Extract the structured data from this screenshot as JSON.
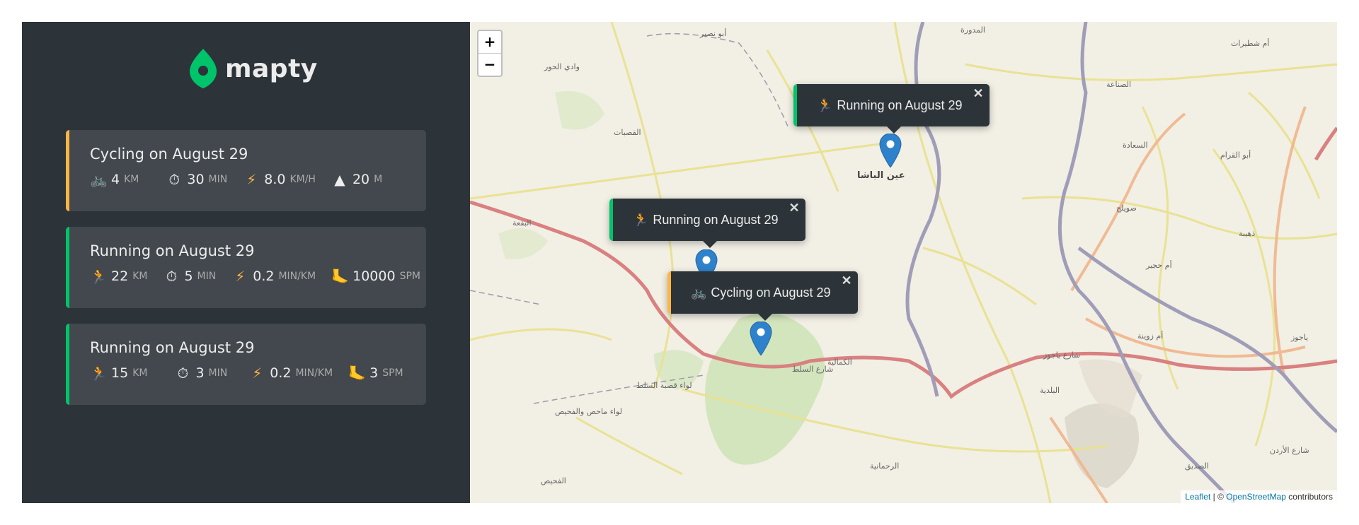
{
  "app": {
    "logo_text": "mapty",
    "accent_colors": {
      "running": "#00c46a",
      "cycling": "#ffb545",
      "sidebar": "#2d3439",
      "card": "#42484d"
    }
  },
  "workouts": [
    {
      "type": "cycling",
      "title": "Cycling on August 29",
      "details": [
        {
          "icon": "bicycle-icon",
          "value": "4",
          "unit": "km"
        },
        {
          "icon": "stopwatch-icon",
          "value": "30",
          "unit": "min"
        },
        {
          "icon": "lightning-icon",
          "value": "8.0",
          "unit": "km/h"
        },
        {
          "icon": "mountain-icon",
          "value": "20",
          "unit": "m"
        }
      ]
    },
    {
      "type": "running",
      "title": "Running on August 29",
      "details": [
        {
          "icon": "runner-icon",
          "value": "22",
          "unit": "km"
        },
        {
          "icon": "stopwatch-icon",
          "value": "5",
          "unit": "min"
        },
        {
          "icon": "lightning-icon",
          "value": "0.2",
          "unit": "min/km"
        },
        {
          "icon": "foot-icon",
          "value": "10000",
          "unit": "spm"
        }
      ]
    },
    {
      "type": "running",
      "title": "Running on August 29",
      "details": [
        {
          "icon": "runner-icon",
          "value": "15",
          "unit": "km"
        },
        {
          "icon": "stopwatch-icon",
          "value": "3",
          "unit": "min"
        },
        {
          "icon": "lightning-icon",
          "value": "0.2",
          "unit": "min/km"
        },
        {
          "icon": "foot-icon",
          "value": "3",
          "unit": "spm"
        }
      ]
    }
  ],
  "map": {
    "zoom_in": "+",
    "zoom_out": "−",
    "popups": [
      {
        "type": "running",
        "text": "Running on August 29",
        "icon": "runner-icon",
        "close": "✕"
      },
      {
        "type": "running",
        "text": "Running on August 29",
        "icon": "runner-icon",
        "close": "✕"
      },
      {
        "type": "cycling",
        "text": "Cycling on August 29",
        "icon": "bicycle-icon",
        "close": "✕"
      }
    ],
    "attribution": {
      "leaflet": "Leaflet",
      "sep": " | © ",
      "osm": "OpenStreetMap",
      "suffix": " contributors"
    },
    "labels": [
      "عين الباشا",
      "وادي الحور",
      "القصبات",
      "أبو نصير",
      "المدورة",
      "الصناعة",
      "السعادة",
      "صويلح",
      "البقعة",
      "الكمالية",
      "أم زوينة",
      "البلدية",
      "الرحمانية",
      "الفحيص",
      "الصديق",
      "ذهيبة",
      "أم حجير",
      "ياجوز",
      "أبو القرام",
      "أم شطيرات",
      "لواء قصبة السلط",
      "لواء ماحص والفحيص",
      "شارع السلط",
      "شارع ياجوز",
      "شارع الأردن"
    ]
  }
}
